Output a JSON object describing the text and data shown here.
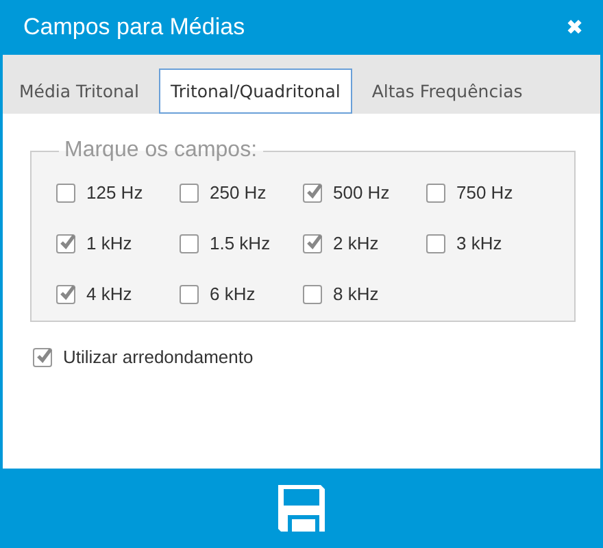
{
  "window": {
    "title": "Campos para Médias",
    "close": "✖"
  },
  "tabs": [
    {
      "label": "Média Tritonal",
      "selected": false
    },
    {
      "label": "Tritonal/Quadritonal",
      "selected": true
    },
    {
      "label": "Altas Frequências",
      "selected": false
    }
  ],
  "fieldset": {
    "legend": "Marque os campos:",
    "fields": [
      {
        "label": "125 Hz",
        "checked": false
      },
      {
        "label": "250 Hz",
        "checked": false
      },
      {
        "label": "500 Hz",
        "checked": true
      },
      {
        "label": "750 Hz",
        "checked": false
      },
      {
        "label": "1 kHz",
        "checked": true
      },
      {
        "label": "1.5 kHz",
        "checked": false
      },
      {
        "label": "2 kHz",
        "checked": true
      },
      {
        "label": "3 kHz",
        "checked": false
      },
      {
        "label": "4 kHz",
        "checked": true
      },
      {
        "label": "6 kHz",
        "checked": false
      },
      {
        "label": "8 kHz",
        "checked": false
      }
    ]
  },
  "rounding": {
    "label": "Utilizar arredondamento",
    "checked": true
  }
}
